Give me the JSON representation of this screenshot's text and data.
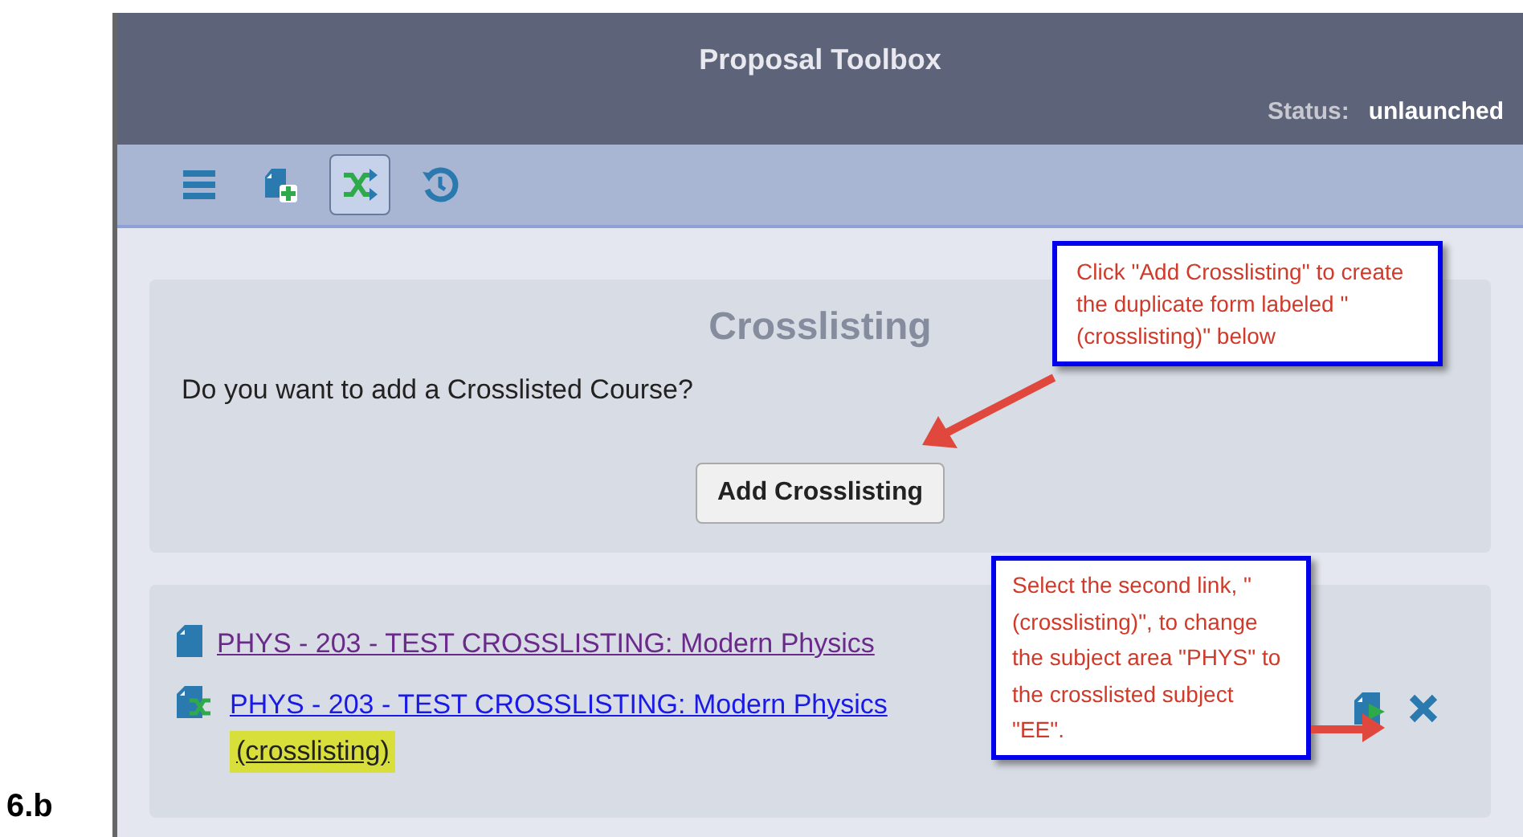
{
  "figure_label": "6.b",
  "header": {
    "title": "Proposal Toolbox",
    "status_label": "Status:",
    "status_value": "unlaunched"
  },
  "toolbar": [
    {
      "kind": "menu",
      "selected": false
    },
    {
      "kind": "add",
      "selected": false
    },
    {
      "kind": "crosslist",
      "selected": true
    },
    {
      "kind": "history",
      "selected": false
    }
  ],
  "crosslisting": {
    "title": "Crosslisting",
    "question": "Do you want to add a Crosslisted Course?",
    "button": "Add Crosslisting"
  },
  "courses": [
    {
      "kind": "original",
      "link": "PHYS - 203 - TEST CROSSLISTING: Modern Physics",
      "visited": true
    },
    {
      "kind": "crosslist",
      "link": "PHYS - 203 - TEST CROSSLISTING: Modern Physics",
      "suffix": "(crosslisting)",
      "visited": false,
      "highlighted": true
    }
  ],
  "callouts": [
    "Click \"Add Crosslisting\" to create the duplicate form labeled \"(crosslisting)\" below",
    "Select the second link, \"(crosslisting)\", to change the subject area \"PHYS\" to the crosslisted subject \"EE\"."
  ]
}
